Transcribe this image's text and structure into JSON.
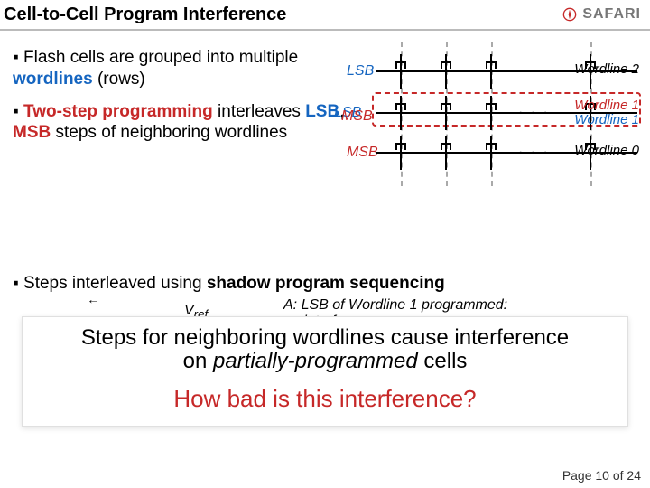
{
  "header": {
    "title": "Cell-to-Cell Program Interference",
    "logo_text": "SAFARI"
  },
  "bullets": {
    "b1_pre": "Flash cells are grouped into multiple ",
    "b1_em": "wordlines",
    "b1_post": " (rows)",
    "b2_pre": "",
    "b2_em": "Two-step programming",
    "b2_mid": " interleaves ",
    "b2_lsb": "LSB",
    "b2_comma": ", ",
    "b2_msb": "MSB",
    "b2_post": " steps of neighboring wordlines"
  },
  "cellarray": {
    "rows": [
      {
        "tag": "LSB",
        "tag_class": "blue",
        "wlabel": "Wordline 2",
        "wlabel_class": ""
      },
      {
        "tag": "LSB",
        "tag_class": "red",
        "wlabel": "Wordline 1",
        "wlabel_class": "red",
        "extra_tag": "MSB",
        "extra_wlabel": "Wordline 1"
      },
      {
        "tag": "MSB",
        "tag_class": "red",
        "wlabel": "Wordline 0",
        "wlabel_class": ""
      }
    ],
    "ellipsis": "· · ·"
  },
  "shadow": {
    "line_pre": "Steps interleaved using ",
    "line_em": "shadow program sequencing",
    "vref": "V",
    "vref_sub": "ref",
    "anno_a": "A: LSB of Wordline 1 programmed:",
    "anno_a2": "no interference"
  },
  "overlay": {
    "line1a": "Steps for neighboring wordlines cause interference",
    "line1b_pre": "on ",
    "line1b_em": "partially-programmed",
    "line1b_post": " cells",
    "line2": "How bad is this interference?"
  },
  "footer": {
    "page": "Page 10 of 24"
  },
  "marker": "▪"
}
